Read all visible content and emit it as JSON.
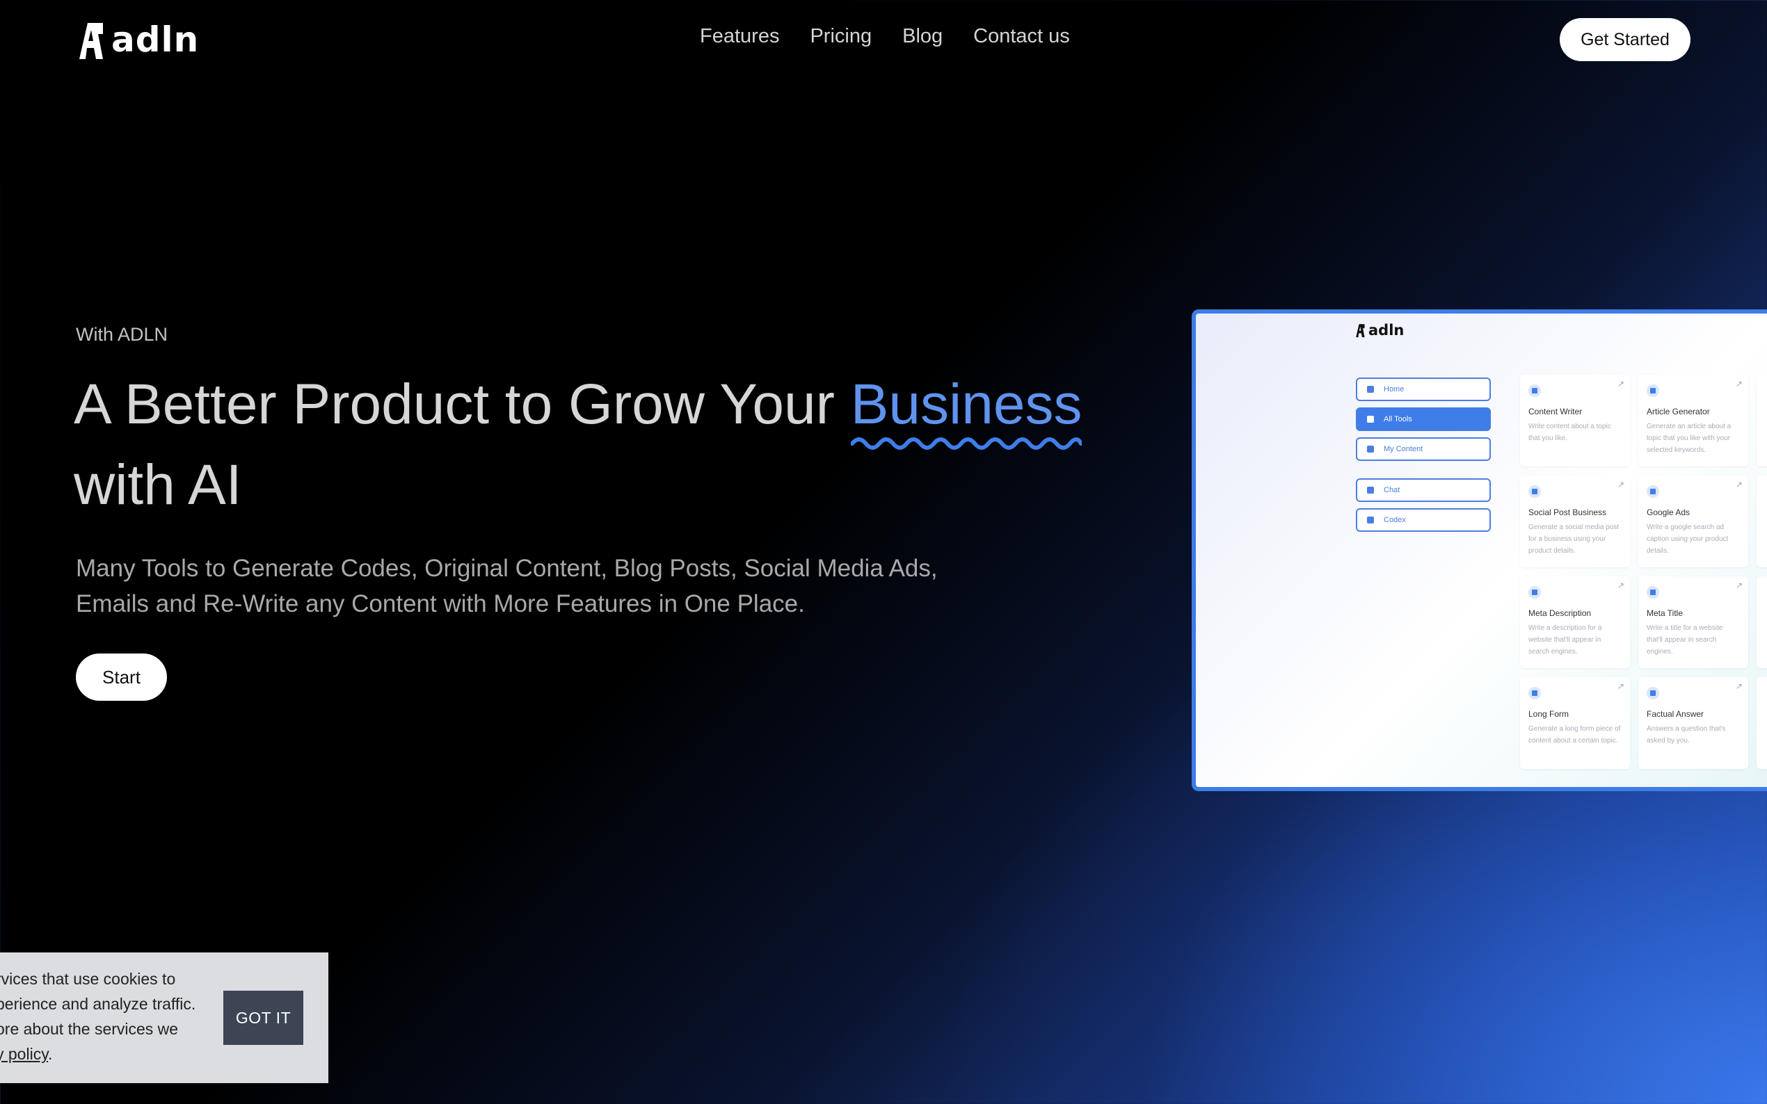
{
  "header": {
    "logo_text": "adln",
    "nav": [
      "Features",
      "Pricing",
      "Blog",
      "Contact us"
    ],
    "cta_label": "Get Started"
  },
  "hero": {
    "eyebrow": "With ADLN",
    "headline_pre": "A Better Product to Grow Your ",
    "headline_accent": "Business",
    "headline_post": " with AI",
    "description": "Many Tools to Generate Codes, Original Content, Blog Posts, Social Media Ads, Emails and Re-Write any Content with More Features in One Place.",
    "start_label": "Start"
  },
  "colors": {
    "accent": "#5f93ef",
    "preview_border": "#3e7de6",
    "cookie_button": "#3d4555"
  },
  "preview": {
    "logo_text": "adln",
    "nav": [
      {
        "label": "Home",
        "active": false
      },
      {
        "label": "All Tools",
        "active": true
      },
      {
        "label": "My Content",
        "active": false
      },
      {
        "label": "Chat",
        "active": false
      },
      {
        "label": "Codex",
        "active": false
      }
    ],
    "cards": [
      {
        "title": "Content Writer",
        "desc": "Write content about a topic that you like."
      },
      {
        "title": "Article Generator",
        "desc": "Generate an article about a topic that you like with your selected keywords."
      },
      {
        "title": "Social Post Business",
        "desc": "Generate a social media post for a business using your product details."
      },
      {
        "title": "Google Ads",
        "desc": "Write a google search ad caption using your product details."
      },
      {
        "title": "Meta Description",
        "desc": "Write a description for a website that'll appear in search engines."
      },
      {
        "title": "Meta Title",
        "desc": "Write a title for a website that'll appear in search engines."
      },
      {
        "title": "Long Form",
        "desc": "Generate a long form piece of content about a certain topic."
      },
      {
        "title": "Factual Answer",
        "desc": "Answers a question that's asked by you."
      }
    ]
  },
  "cookie": {
    "line1": "rvices that use cookies to",
    "line2": "perience and analyze traffic.",
    "line3": "ore about the services we",
    "link": "y policy",
    "end": ".",
    "button": "GOT IT"
  }
}
